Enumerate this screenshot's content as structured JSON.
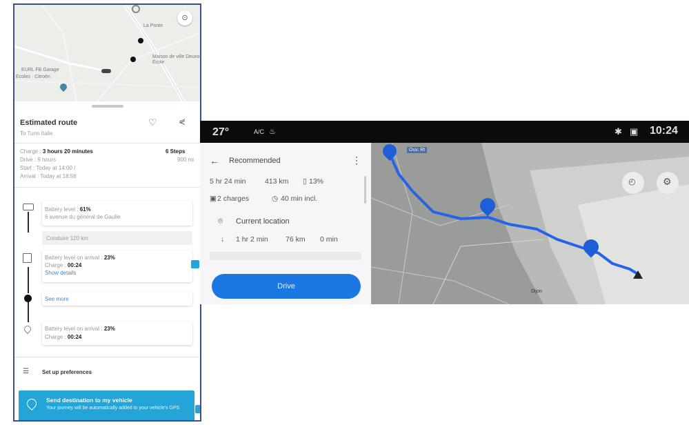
{
  "phone": {
    "map_labels": [
      "La Ponte",
      "Maison de ville Deuxo Ecole",
      "EURL FB Garage",
      "Ecoles · Citroën"
    ],
    "route_title": "Estimated route",
    "route_subtitle": "To Turin Italie",
    "charge_label": "Charge :",
    "charge_value": "3 hours 20 minutes",
    "steps_label": "6 Steps",
    "steps_distance": "900 mi",
    "drive_text": "Drive : 9 hours",
    "start_text": "Start : Today at 14:00 /",
    "arrival_text": "Arrival : Today at 18:56",
    "start_label": "Battery level :",
    "start_value": "61%",
    "start_address": "6 avenue du général de Gaulle",
    "drive_segment": "Conduire 120 km",
    "charge_stop": {
      "label": "Battery level on arrival :",
      "value": "23%",
      "charge_label": "Charge :",
      "charge_value": "00:24",
      "details_link": "Show details"
    },
    "see_more": "See more",
    "end_stop": {
      "label": "Battery level on arrival :",
      "value": "23%",
      "charge_label": "Charge :",
      "charge_value": "00:24"
    },
    "preferences": "Set up preferences",
    "send_title": "Send destination to my vehicle",
    "send_desc": "Your journey will be automatically added to your vehicle's GPS"
  },
  "car": {
    "temperature": "27°",
    "ac": "A/C",
    "clock": "10:24",
    "header": "Recommended",
    "duration": "5 hr 24 min",
    "distance": "413 km",
    "battery": "13%",
    "charges": "2 charges",
    "charge_time": "40 min incl.",
    "current_location": "Current location",
    "leg_time": "1 hr 2 min",
    "leg_distance": "76 km",
    "leg_wait": "0 min",
    "drive_button": "Drive",
    "map_labels": [
      "Ouv. Rt",
      "Dijon"
    ],
    "route_color": "#2563eb",
    "accent": "#1b78e2"
  }
}
